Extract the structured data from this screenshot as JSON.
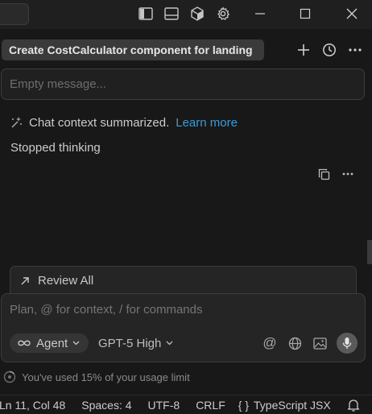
{
  "titlebar": {
    "icons": [
      "toggle-primary-sidebar-icon",
      "toggle-panel-icon",
      "cube-icon",
      "gear-icon",
      "minimize-icon",
      "maximize-icon",
      "close-icon"
    ]
  },
  "chat": {
    "title": "Create CostCalculator component for landing",
    "actions": [
      "plus-icon",
      "history-icon",
      "more-icon"
    ],
    "empty_message": "Empty message...",
    "summary_text": "Chat context summarized.",
    "summary_link": "Learn more",
    "stopped_text": "Stopped thinking"
  },
  "review": {
    "label": "Review All"
  },
  "composer": {
    "placeholder": "Plan, @ for context, / for commands",
    "mode_label": "Agent",
    "model_label": "GPT-5 High",
    "at_symbol": "@"
  },
  "usage": {
    "text": "You've used 15% of your usage limit"
  },
  "statusbar": {
    "position": "Ln 11, Col 48",
    "spaces": "Spaces: 4",
    "encoding": "UTF-8",
    "eol": "CRLF",
    "language": "TypeScript JSX",
    "language_icon": "{ }"
  },
  "colors": {
    "link": "#3e9bd6",
    "background": "#181818",
    "panel": "#252525"
  }
}
